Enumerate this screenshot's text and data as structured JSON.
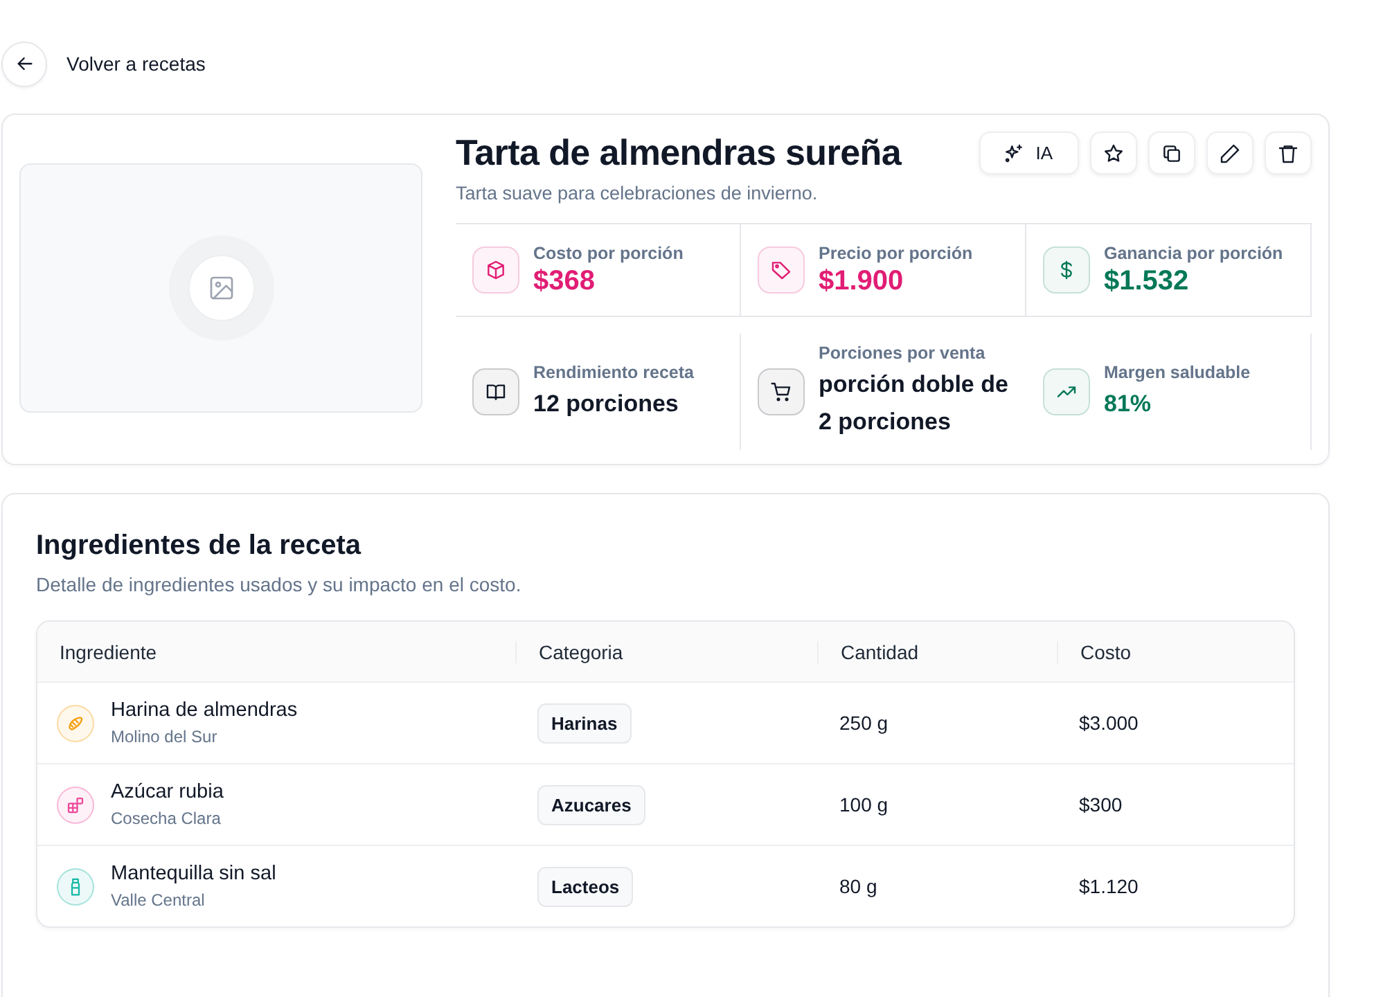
{
  "back_link": {
    "label": "Volver a recetas"
  },
  "recipe": {
    "title": "Tarta de almendras sureña",
    "subtitle": "Tarta suave para celebraciones de invierno.",
    "actions": [
      {
        "label": "IA"
      }
    ],
    "stats": [
      {
        "label": "Costo por porción",
        "value": "$368",
        "color": "#e11d74"
      },
      {
        "label": "Precio por porción",
        "value": "$1.900",
        "color": "#e11d74"
      },
      {
        "label": "Ganancia por porción",
        "value": "$1.532",
        "color": "#047857"
      },
      {
        "label": "Rendimiento receta",
        "value": "12 porciones",
        "color": "#111827"
      },
      {
        "label": "Porciones por venta",
        "value": "porción doble de 2 porciones",
        "color": "#111827"
      },
      {
        "label": "Margen saludable",
        "value": "81%",
        "color": "#047857"
      }
    ]
  },
  "ingredients": {
    "title": "Ingredientes de la receta",
    "subtitle": "Detalle de ingredientes usados y su impacto en el costo.",
    "table": {
      "columns": [
        "Ingrediente",
        "Categoria",
        "Cantidad",
        "Costo"
      ],
      "rows": [
        {
          "name": "Harina de almendras",
          "supplier": "Molino del Sur",
          "category": "Harinas",
          "quantity": "250 g",
          "cost": "$3.000",
          "color": "#f59e0b"
        },
        {
          "name": "Azúcar rubia",
          "supplier": "Cosecha Clara",
          "category": "Azucares",
          "quantity": "100 g",
          "cost": "$300",
          "color": "#ec4899"
        },
        {
          "name": "Mantequilla sin sal",
          "supplier": "Valle Central",
          "category": "Lacteos",
          "quantity": "80 g",
          "cost": "$1.120",
          "color": "#14b8a6"
        }
      ]
    }
  }
}
